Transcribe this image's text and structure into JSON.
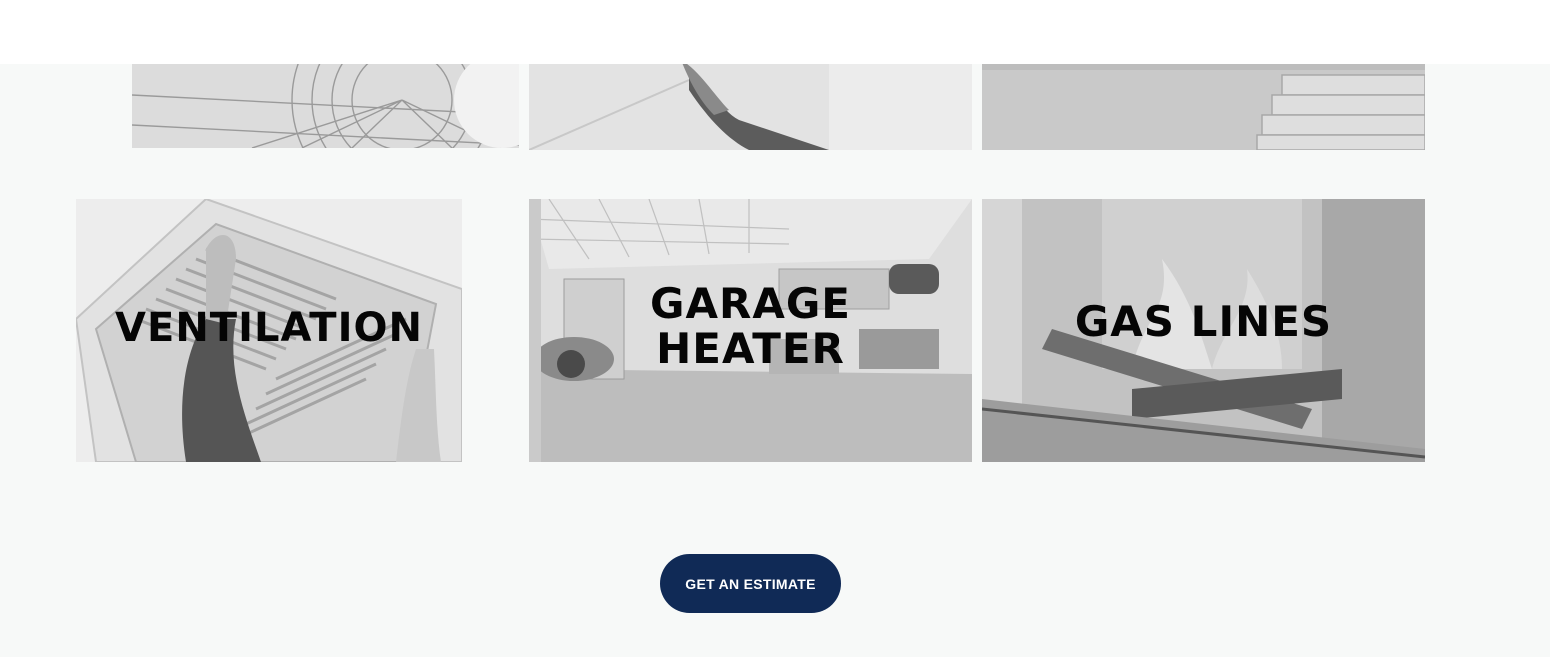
{
  "tiles": {
    "ventilation": {
      "label": "VENTILATION"
    },
    "garage_heater": {
      "label_line1": "GARAGE",
      "label_line2": "HEATER"
    },
    "gas_lines": {
      "label": "GAS LINES"
    }
  },
  "cta": {
    "label": "GET AN ESTIMATE"
  },
  "colors": {
    "page_background": "#f7f9f8",
    "cta_background": "#102a56",
    "cta_text": "#ffffff",
    "tile_label": "#050505"
  }
}
